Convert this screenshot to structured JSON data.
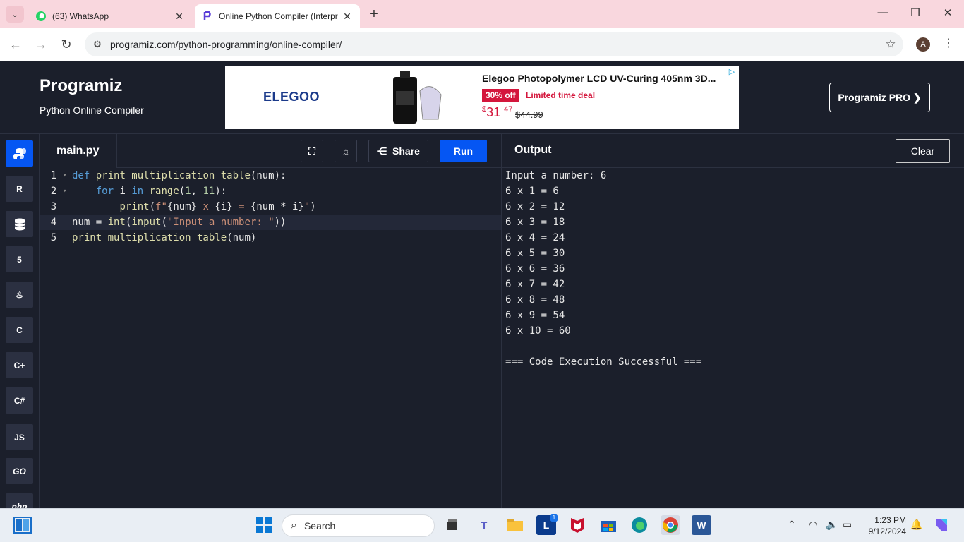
{
  "browser": {
    "tabs": [
      {
        "title": "(63) WhatsApp",
        "icon": "whatsapp-icon"
      },
      {
        "title": "Online Python Compiler (Interpr",
        "icon": "programiz-icon"
      }
    ],
    "url": "programiz.com/python-programming/online-compiler/",
    "profile_initial": "A"
  },
  "header": {
    "logo": "Programiz",
    "subtitle": "Python Online Compiler",
    "pro_button": "Programiz PRO ❯"
  },
  "ad": {
    "brand": "ELEGOO",
    "headline": "Elegoo Photopolymer LCD UV-Curing 405nm 3D...",
    "discount": "30% off",
    "deal": "Limited time deal",
    "price_dollar": "$",
    "price_whole": "31",
    "price_cents": "47",
    "old_price": "$44.99"
  },
  "editor": {
    "filename": "main.py",
    "share_label": "Share",
    "run_label": "Run",
    "line_numbers": [
      "1",
      "2",
      "3",
      "4",
      "5"
    ]
  },
  "output": {
    "title": "Output",
    "clear_label": "Clear",
    "lines": [
      "Input a number: 6",
      "6 x 1 = 6",
      "6 x 2 = 12",
      "6 x 3 = 18",
      "6 x 4 = 24",
      "6 x 5 = 30",
      "6 x 6 = 36",
      "6 x 7 = 42",
      "6 x 8 = 48",
      "6 x 9 = 54",
      "6 x 10 = 60",
      "",
      "=== Code Execution Successful ==="
    ]
  },
  "sidebar": {
    "languages": [
      "python-icon",
      "r-icon",
      "sql-icon",
      "html5-icon",
      "java-icon",
      "c-icon",
      "cpp-icon",
      "csharp-icon",
      "JS",
      "GO",
      "php"
    ]
  },
  "taskbar": {
    "search_placeholder": "Search",
    "time": "1:23 PM",
    "date": "9/12/2024",
    "badge": "1"
  }
}
